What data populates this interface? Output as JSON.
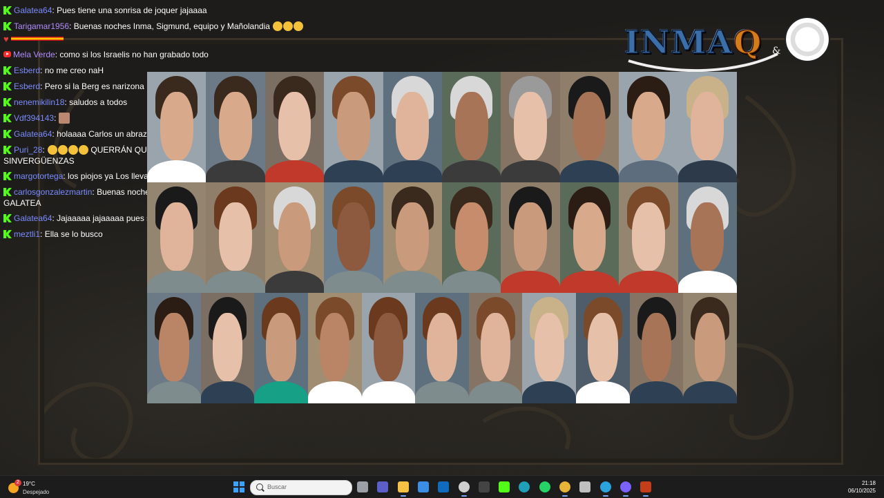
{
  "chat": {
    "messages": [
      {
        "user": "Galatea64",
        "text": "Pues tiene una sonrisa de joquer jajaaaa"
      },
      {
        "user": "Tarigamar1956",
        "text": "Buenas noches Inma, Sigmund, equipo y Mañolandia"
      },
      {
        "user": "Mela Verde",
        "text": "como si los Israelis no han grabado todo"
      },
      {
        "user": "Esberd",
        "text": "no me creo naH"
      },
      {
        "user": "Esberd",
        "text": "Pero si la Berg es narizona"
      },
      {
        "user": "nenemikilin18",
        "text": "saludos a todos"
      },
      {
        "user": "Vdf394143",
        "text": ""
      },
      {
        "user": "Galatea64",
        "text": "holaaaa Carlos un abrazo"
      },
      {
        "user": "Puri_28",
        "text": "QUERRÁN QUE LES PONGAN UN HOTEL LA SINVERGÜENZAS"
      },
      {
        "user": "margotortega",
        "text": "los piojos ya Los llevaba puestos"
      },
      {
        "user": "carlosgonzalezmartin",
        "text": "Buenas noches Legionaria un gran abrazo GALATEA"
      },
      {
        "user": "Galatea64",
        "text": "Jajaaaaa jajaaaaa pues se la ve muy agustito"
      },
      {
        "user": "meztli1",
        "text": "Ella se lo busco"
      }
    ]
  },
  "logo": {
    "text_main": "INMA",
    "text_q": "Q",
    "text_amp": "&"
  },
  "photo_grid": {
    "rows": [
      {
        "count": 10
      },
      {
        "count": 10
      },
      {
        "count": 11
      }
    ]
  },
  "taskbar": {
    "weather_temp": "19°C",
    "weather_desc": "Despejado",
    "weather_badge": "2",
    "search_placeholder": "Buscar",
    "time": "21:18",
    "date": "06/10/2025",
    "icons": [
      "task-view-icon",
      "teams-icon",
      "file-explorer-icon",
      "microsoft-store-icon",
      "outlook-icon",
      "obs-icon",
      "unity-icon",
      "kick-icon",
      "edge-icon",
      "whatsapp-icon",
      "chrome-icon",
      "shield-icon",
      "telegram-icon",
      "circle-app-icon",
      "powerpoint-icon"
    ]
  }
}
